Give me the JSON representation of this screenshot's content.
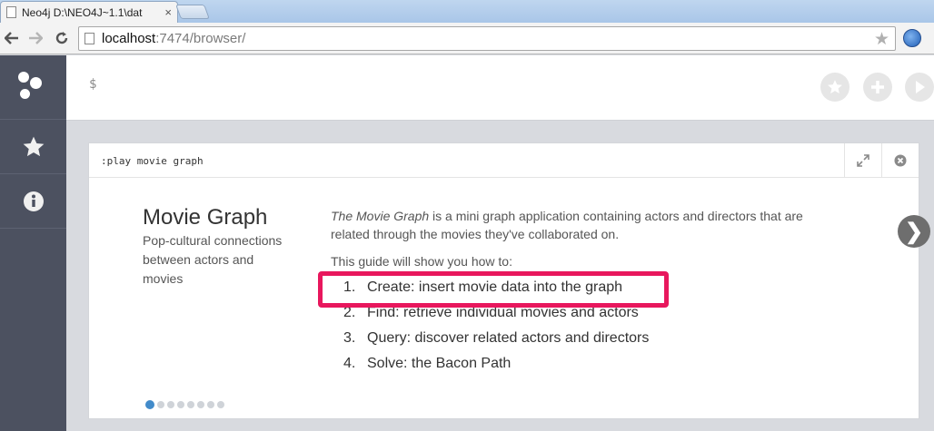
{
  "browser": {
    "tab_title": "Neo4j D:\\NEO4J~1.1\\dat",
    "tab_close": "×",
    "url_host": "localhost",
    "url_rest": ":7474/browser/"
  },
  "sidebar": {
    "items": [
      {
        "icon": "star-icon"
      },
      {
        "icon": "info-icon"
      }
    ]
  },
  "editor": {
    "prompt": "$"
  },
  "frame": {
    "command": ":play movie graph"
  },
  "guide": {
    "title": "Movie Graph",
    "subtitle": "Pop-cultural connections between actors and movies",
    "intro_em": "The Movie Graph",
    "intro_rest": " is a mini graph application containing actors and directors that are related through the movies they've collaborated on.",
    "lead": "This guide will show you how to:",
    "steps": [
      {
        "num": "1.",
        "text": "Create: insert movie data into the graph"
      },
      {
        "num": "2.",
        "text": "Find: retrieve individual movies and actors"
      },
      {
        "num": "3.",
        "text": "Query: discover related actors and directors"
      },
      {
        "num": "4.",
        "text": "Solve: the Bacon Path"
      }
    ]
  },
  "carousel": {
    "next_label": "❯",
    "total_slides": 8,
    "active_slide": 1
  },
  "colors": {
    "highlight": "#e8175d",
    "sidebar": "#4c5160",
    "active_dot": "#428bca"
  }
}
